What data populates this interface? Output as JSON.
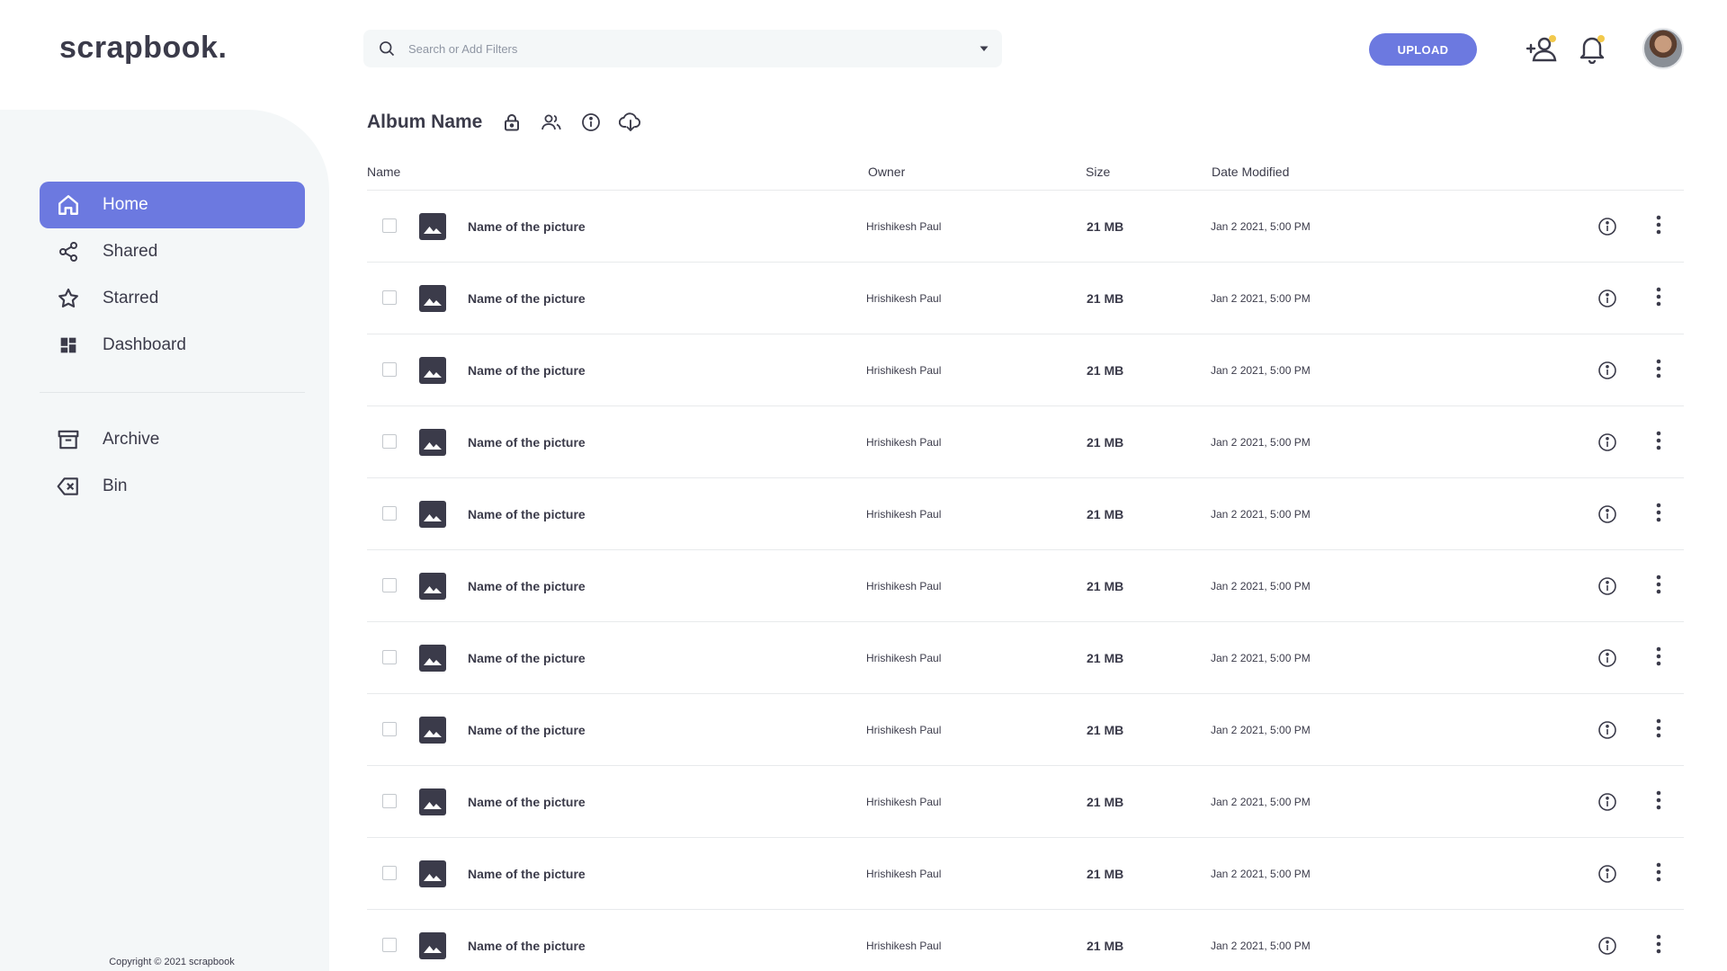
{
  "app": {
    "logo": "scrapbook."
  },
  "sidebar": {
    "items": [
      {
        "label": "Home",
        "icon": "home-icon",
        "active": true
      },
      {
        "label": "Shared",
        "icon": "share-icon",
        "active": false
      },
      {
        "label": "Starred",
        "icon": "star-icon",
        "active": false
      },
      {
        "label": "Dashboard",
        "icon": "dashboard-icon",
        "active": false
      }
    ],
    "secondary_items": [
      {
        "label": "Archive",
        "icon": "archive-icon"
      },
      {
        "label": "Bin",
        "icon": "backspace-icon"
      }
    ],
    "copyright": "Copyright © 2021 scrapbook"
  },
  "search": {
    "placeholder": "Search or Add Filters",
    "value": ""
  },
  "header": {
    "upload_label": "UPLOAD",
    "add_user_icon": "add-user-icon",
    "notification_icon": "bell-icon"
  },
  "album": {
    "title": "Album Name",
    "icons": [
      "lock-icon",
      "people-icon",
      "info-icon",
      "cloud-download-icon"
    ]
  },
  "table": {
    "columns": {
      "name": "Name",
      "owner": "Owner",
      "size": "Size",
      "date": "Date Modified"
    },
    "rows": [
      {
        "name": "Name of the picture",
        "owner": "Hrishikesh Paul",
        "size": "21 MB",
        "date": "Jan 2 2021, 5:00 PM"
      },
      {
        "name": "Name of the picture",
        "owner": "Hrishikesh Paul",
        "size": "21 MB",
        "date": "Jan 2 2021, 5:00 PM"
      },
      {
        "name": "Name of the picture",
        "owner": "Hrishikesh Paul",
        "size": "21 MB",
        "date": "Jan 2 2021, 5:00 PM"
      },
      {
        "name": "Name of the picture",
        "owner": "Hrishikesh Paul",
        "size": "21 MB",
        "date": "Jan 2 2021, 5:00 PM"
      },
      {
        "name": "Name of the picture",
        "owner": "Hrishikesh Paul",
        "size": "21 MB",
        "date": "Jan 2 2021, 5:00 PM"
      },
      {
        "name": "Name of the picture",
        "owner": "Hrishikesh Paul",
        "size": "21 MB",
        "date": "Jan 2 2021, 5:00 PM"
      },
      {
        "name": "Name of the picture",
        "owner": "Hrishikesh Paul",
        "size": "21 MB",
        "date": "Jan 2 2021, 5:00 PM"
      },
      {
        "name": "Name of the picture",
        "owner": "Hrishikesh Paul",
        "size": "21 MB",
        "date": "Jan 2 2021, 5:00 PM"
      },
      {
        "name": "Name of the picture",
        "owner": "Hrishikesh Paul",
        "size": "21 MB",
        "date": "Jan 2 2021, 5:00 PM"
      },
      {
        "name": "Name of the picture",
        "owner": "Hrishikesh Paul",
        "size": "21 MB",
        "date": "Jan 2 2021, 5:00 PM"
      },
      {
        "name": "Name of the picture",
        "owner": "Hrishikesh Paul",
        "size": "21 MB",
        "date": "Jan 2 2021, 5:00 PM"
      }
    ]
  },
  "colors": {
    "accent": "#6c79e0",
    "sidebar_bg": "#f4f7f8",
    "text": "#3b3b4a",
    "badge": "#f2c94c"
  }
}
